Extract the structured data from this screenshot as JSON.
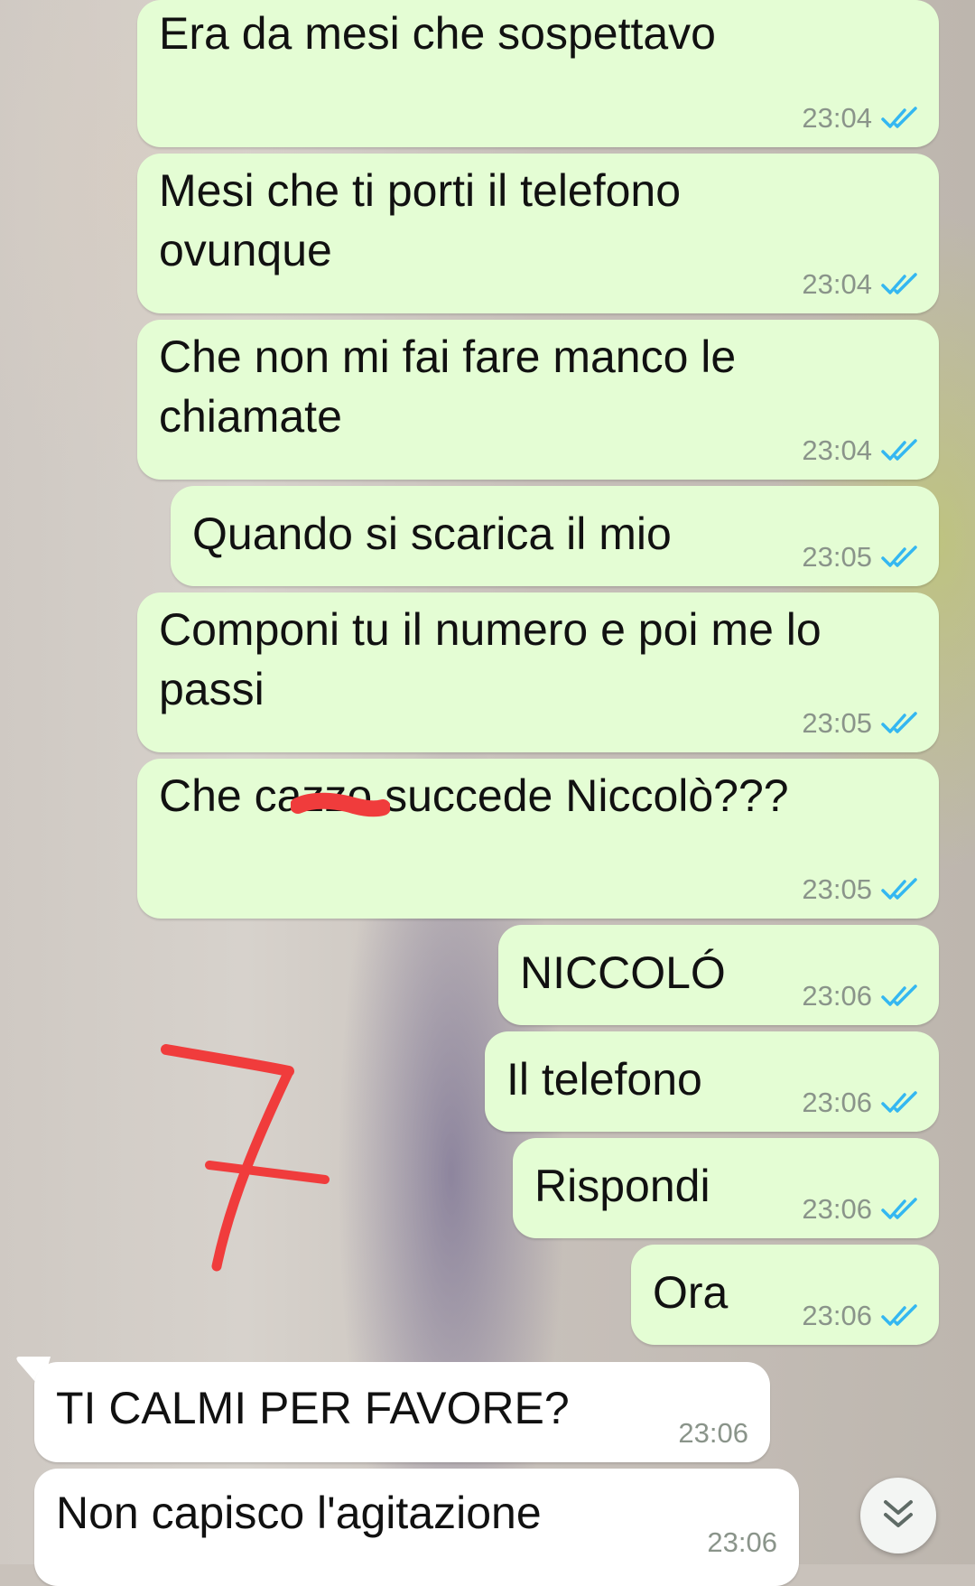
{
  "messages": [
    {
      "text": "Era da mesi che sospettavo",
      "time": "23:04",
      "direction": "outgoing",
      "status": "read"
    },
    {
      "text": "Mesi che ti porti il telefono ovunque",
      "time": "23:04",
      "direction": "outgoing",
      "status": "read"
    },
    {
      "text": "Che non mi fai fare manco le chiamate",
      "time": "23:04",
      "direction": "outgoing",
      "status": "read"
    },
    {
      "text": "Quando si scarica il mio",
      "time": "23:05",
      "direction": "outgoing",
      "status": "read"
    },
    {
      "text": "Componi tu il numero e poi me lo passi",
      "time": "23:05",
      "direction": "outgoing",
      "status": "read"
    },
    {
      "text": "Che cazzo succede Niccolò???",
      "time": "23:05",
      "direction": "outgoing",
      "status": "read"
    },
    {
      "text": "NICCOLÓ",
      "time": "23:06",
      "direction": "outgoing",
      "status": "read"
    },
    {
      "text": "Il telefono",
      "time": "23:06",
      "direction": "outgoing",
      "status": "read"
    },
    {
      "text": "Rispondi",
      "time": "23:06",
      "direction": "outgoing",
      "status": "read"
    },
    {
      "text": "Ora",
      "time": "23:06",
      "direction": "outgoing",
      "status": "read"
    },
    {
      "text": "TI CALMI PER FAVORE?",
      "time": "23:06",
      "direction": "incoming"
    },
    {
      "text": "Non capisco l'agitazione",
      "time": "23:06",
      "direction": "incoming"
    }
  ],
  "annotation": {
    "label": "7",
    "color": "#f03c3c"
  },
  "icons": {
    "read_receipt": "double-check-icon",
    "scroll_down": "chevron-double-down-icon"
  },
  "colors": {
    "outgoing_bubble": "#e4fdd4",
    "incoming_bubble": "#ffffff",
    "read_tick": "#34b7f1"
  }
}
